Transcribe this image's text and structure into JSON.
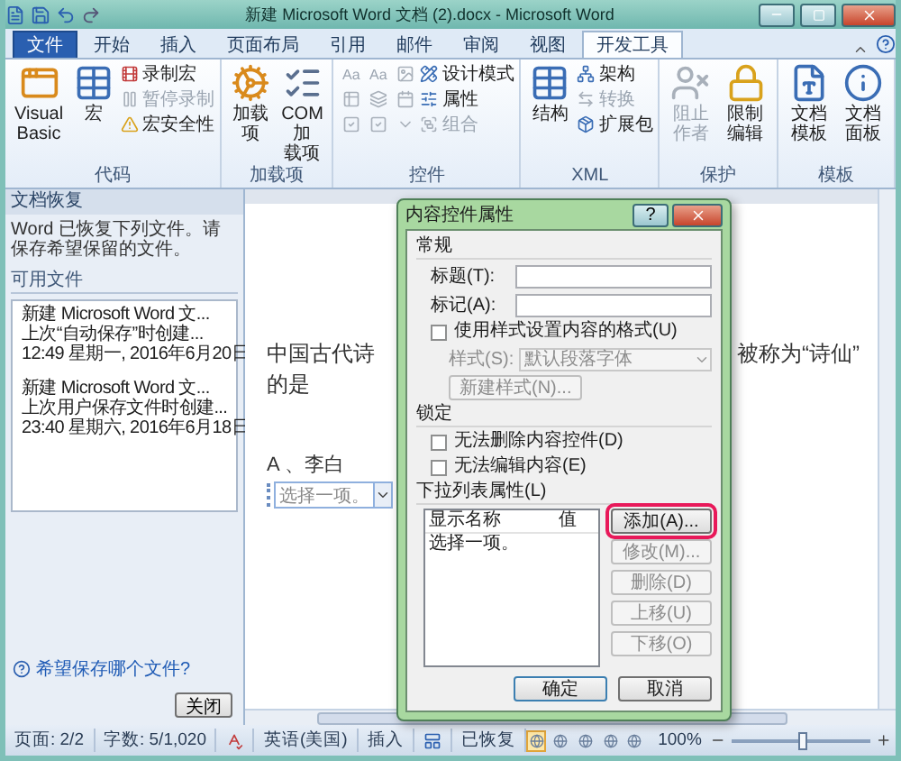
{
  "window": {
    "title": "新建 Microsoft Word 文档 (2).docx - Microsoft Word"
  },
  "tabs": [
    {
      "label": "文件",
      "kind": "file",
      "selected": false
    },
    {
      "label": "开始",
      "kind": "tab",
      "selected": false
    },
    {
      "label": "插入",
      "kind": "tab",
      "selected": false
    },
    {
      "label": "页面布局",
      "kind": "tab",
      "selected": false
    },
    {
      "label": "引用",
      "kind": "tab",
      "selected": false
    },
    {
      "label": "邮件",
      "kind": "tab",
      "selected": false
    },
    {
      "label": "审阅",
      "kind": "tab",
      "selected": false
    },
    {
      "label": "视图",
      "kind": "tab",
      "selected": false
    },
    {
      "label": "开发工具",
      "kind": "tab",
      "selected": true
    }
  ],
  "ribbon": {
    "groups": [
      {
        "label": "代码",
        "items": [
          {
            "kind": "large",
            "label": "Visual Basic",
            "disabled": false
          },
          {
            "kind": "large",
            "label": "宏",
            "disabled": false
          },
          {
            "kind": "stack",
            "items": [
              {
                "label": "录制宏",
                "disabled": false
              },
              {
                "label": "暂停录制",
                "disabled": true
              },
              {
                "label": "宏安全性",
                "disabled": false
              }
            ]
          }
        ]
      },
      {
        "label": "加载项",
        "items": [
          {
            "kind": "large",
            "label": "加载项",
            "disabled": false
          },
          {
            "kind": "large",
            "label": "COM 加载项",
            "disabled": false
          }
        ]
      },
      {
        "label": "控件",
        "items": [
          {
            "kind": "grid",
            "cells": [
              {
                "kind": "glyph",
                "label": "Aa",
                "disabled": true
              },
              {
                "kind": "glyph",
                "label": "Aa",
                "disabled": true
              },
              {
                "kind": "icon",
                "disabled": true
              },
              {
                "kind": "icon",
                "disabled": true
              },
              {
                "kind": "icon",
                "disabled": true
              },
              {
                "kind": "icon",
                "disabled": true
              },
              {
                "kind": "icon",
                "disabled": true
              },
              {
                "kind": "icon",
                "disabled": true
              },
              {
                "kind": "icon",
                "disabled": true
              }
            ]
          },
          {
            "kind": "stack",
            "items": [
              {
                "label": "设计模式",
                "disabled": false
              },
              {
                "label": "属性",
                "disabled": false
              },
              {
                "label": "组合",
                "disabled": true
              }
            ]
          }
        ]
      },
      {
        "label": "XML",
        "items": [
          {
            "kind": "large",
            "label": "结构",
            "disabled": false
          },
          {
            "kind": "stack",
            "items": [
              {
                "label": "架构",
                "disabled": false
              },
              {
                "label": "转换",
                "disabled": true
              },
              {
                "label": "扩展包",
                "disabled": false
              }
            ]
          }
        ]
      },
      {
        "label": "保护",
        "items": [
          {
            "kind": "large",
            "label": "阻止作者",
            "disabled": true
          },
          {
            "kind": "large",
            "label": "限制编辑",
            "disabled": false
          }
        ]
      },
      {
        "label": "模板",
        "items": [
          {
            "kind": "large",
            "label": "文档模板",
            "disabled": false
          },
          {
            "kind": "large",
            "label": "文档面板",
            "disabled": false
          }
        ]
      }
    ]
  },
  "recovery_pane": {
    "title": "文档恢复",
    "message": "Word 已恢复下列文件。请保存希望保留的文件。",
    "section": "可用文件",
    "files": [
      {
        "name": "新建 Microsoft Word 文...",
        "note": "上次“自动保存”时创建...",
        "time": "12:49 星期一, 2016年6月20日"
      },
      {
        "name": "新建 Microsoft Word 文...",
        "note": "上次用户保存文件时创建...",
        "time": "23:40 星期六, 2016年6月18日"
      }
    ],
    "help_link": "希望保存哪个文件?",
    "close_button": "关闭"
  },
  "document": {
    "line_start": "中国古代诗",
    "line_end": "被称为“诗仙”",
    "line_2": "的是",
    "option": "A 、李白",
    "dropdown_placeholder": "选择一项。"
  },
  "dialog": {
    "title": "内容控件属性",
    "help_button": "?",
    "general": {
      "heading": "常规",
      "fields": [
        {
          "label": "标题(T):"
        },
        {
          "label": "标记(A):"
        }
      ],
      "style_checkbox": {
        "label": "使用样式设置内容的格式(U)",
        "checked": false
      },
      "style_select": {
        "label": "样式(S):",
        "value": "默认段落字体",
        "disabled": true
      },
      "new_style_button": {
        "label": "新建样式(N)...",
        "disabled": true
      }
    },
    "locking": {
      "heading": "锁定",
      "checkboxes": [
        {
          "label": "无法删除内容控件(D)",
          "checked": false
        },
        {
          "label": "无法编辑内容(E)",
          "checked": false
        }
      ]
    },
    "dropdown_properties": {
      "heading": "下拉列表属性(L)",
      "columns": [
        "显示名称",
        "值"
      ],
      "rows": [
        {
          "display_name": "选择一项。",
          "selected": false
        }
      ],
      "buttons": [
        {
          "label": "添加(A)...",
          "disabled": false,
          "highlighted": true
        },
        {
          "label": "修改(M)...",
          "disabled": true,
          "highlighted": false
        },
        {
          "label": "删除(D)",
          "disabled": true,
          "highlighted": false
        },
        {
          "label": "上移(U)",
          "disabled": true,
          "highlighted": false
        },
        {
          "label": "下移(O)",
          "disabled": true,
          "highlighted": false
        }
      ]
    },
    "footer_buttons": [
      {
        "label": "确定",
        "default": true
      },
      {
        "label": "取消",
        "default": false
      }
    ]
  },
  "status_bar": {
    "items": [
      {
        "kind": "text",
        "label": "页面: 2/2"
      },
      {
        "kind": "text",
        "label": "字数: 5/1,020"
      },
      {
        "kind": "icon"
      },
      {
        "kind": "text",
        "label": "英语(美国)"
      },
      {
        "kind": "text",
        "label": "插入"
      },
      {
        "kind": "icon"
      },
      {
        "kind": "text",
        "label": "已恢复"
      }
    ],
    "views": [
      {
        "selected": true
      },
      {
        "selected": false
      },
      {
        "selected": false
      },
      {
        "selected": false
      },
      {
        "selected": false
      }
    ],
    "zoom": {
      "label": "100%",
      "level": 0.5
    }
  }
}
